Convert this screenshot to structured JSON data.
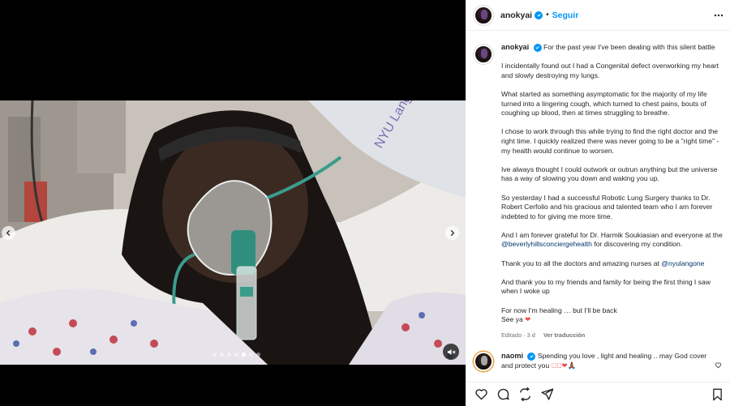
{
  "post": {
    "username": "anokyai",
    "separator": "•",
    "follow_label": "Seguir",
    "more_icon": "more-horizontal-icon"
  },
  "caption": {
    "username": "anokyai",
    "paragraphs": [
      "For the past year I've been dealing with this silent battle",
      "I incidentally found out I had a Congenital defect overworking my heart and slowly destroying my lungs.",
      "What started as something asymptomatic for the majority of my life turned into a lingering cough, which turned to chest pains, bouts of coughing up blood, then at times struggling to breathe.",
      "I chose to work through this while trying to find the right doctor and the right time. I quickly realized there was never going to be a \"right time\" - my health would continue to worsen.",
      "Ive always thought I could outwork or outrun anything but the universe has a way of slowing you down and waking you up.",
      "So yesterday I had a successful Robotic Lung Surgery thanks to Dr. Robert Cerfolio and his gracious and talented team who I am forever indebted to for giving me more time."
    ],
    "p7_before": "And I am forever grateful for Dr. Harmik Soukiasian and everyone at the ",
    "p7_mention": "@beverlyhillsconciergehealth",
    "p7_after": " for discovering my condition.",
    "p8_before": "Thank you to all the doctors and amazing nurses at ",
    "p8_mention": "@nyulangone",
    "p9": "And thank you to my friends and family for being the first thing I saw when I woke up",
    "p10_line1": "For now I'm healing … but I'll be back",
    "p10_line2": "See ya",
    "p10_heart": "❤",
    "edited": "Editado · 3 d",
    "translate": "Ver traducción"
  },
  "comment": {
    "username": "naomi",
    "text": "Spending you love , light and healing .. may God cover and protect you",
    "emojis": "❤🏾❤🙏🏾"
  },
  "media": {
    "dots_count": 7,
    "active_dot": 4,
    "prev_icon": "chevron-left-icon",
    "next_icon": "chevron-right-icon",
    "mute_icon": "muted-speaker-icon"
  },
  "actions": {
    "like_icon": "heart-icon",
    "comment_icon": "comment-icon",
    "share_icon": "share-icon",
    "send_icon": "send-icon",
    "save_icon": "bookmark-icon"
  },
  "colors": {
    "accent": "#0095f6",
    "mention": "#00376b",
    "heart": "#ed4956",
    "meta": "#737373"
  }
}
